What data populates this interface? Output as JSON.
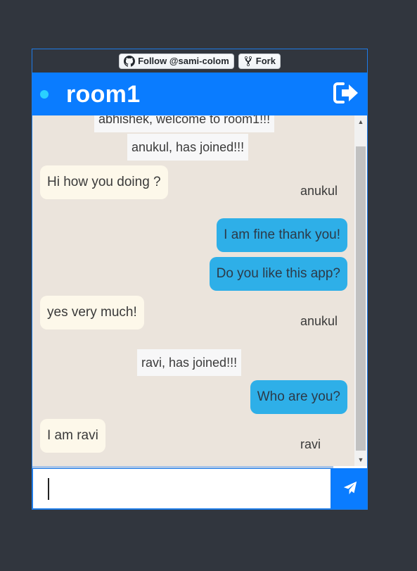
{
  "github": {
    "follow_label": "Follow @sami-colom",
    "fork_label": "Fork"
  },
  "header": {
    "room_name": "room1"
  },
  "messages": {
    "notice_top": "abhishek, welcome to room1!!!",
    "notice_anukul": "anukul, has joined!!!",
    "msg1_text": "Hi how you doing ?",
    "msg1_sender": "anukul",
    "msg2_text": "I am fine thank you!",
    "msg3_text": "Do you like this app?",
    "msg4_text": "yes very much!",
    "msg4_sender": "anukul",
    "notice_ravi": "ravi, has joined!!!",
    "msg5_text": "Who are you?",
    "msg6_text": "I am ravi",
    "msg6_sender": "ravi"
  },
  "composer": {
    "value": ""
  },
  "colors": {
    "header": "#0a7cff",
    "outgoing_bubble": "#2eafe8",
    "incoming_bubble": "#fdf8ea",
    "chat_background": "#ebe4dc",
    "status_dot": "#2ad0ff"
  },
  "icons": {
    "github": "github-icon",
    "fork": "fork-icon",
    "status": "online-dot",
    "exit": "sign-out-icon",
    "send": "paper-plane-icon"
  }
}
